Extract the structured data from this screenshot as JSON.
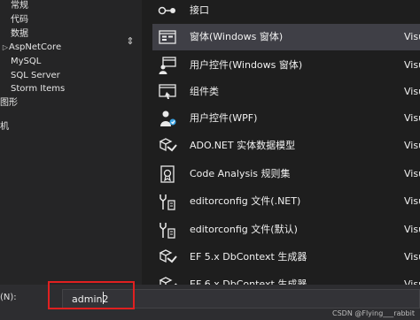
{
  "tree": {
    "items": [
      {
        "label": "常规",
        "twisty": ""
      },
      {
        "label": "代码",
        "twisty": ""
      },
      {
        "label": "数据",
        "twisty": ""
      },
      {
        "label": "AspNetCore",
        "twisty": "▷"
      },
      {
        "label": "MySQL",
        "twisty": ""
      },
      {
        "label": "SQL Server",
        "twisty": ""
      },
      {
        "label": "Storm Items",
        "twisty": ""
      },
      {
        "label": "图形",
        "twisty": ""
      },
      {
        "label": "机",
        "twisty": ""
      }
    ],
    "resize_glyph": "⇕"
  },
  "templates": [
    {
      "name": "接口",
      "lang": "",
      "icon": "interface-icon",
      "selected": false
    },
    {
      "name": "窗体(Windows 窗体)",
      "lang": "Visu",
      "icon": "form-icon",
      "selected": true
    },
    {
      "name": "用户控件(Windows 窗体)",
      "lang": "Visu",
      "icon": "user-control-icon",
      "selected": false
    },
    {
      "name": "组件类",
      "lang": "Visu",
      "icon": "component-icon",
      "selected": false
    },
    {
      "name": "用户控件(WPF)",
      "lang": "Visu",
      "icon": "wpf-user-control-icon",
      "selected": false
    },
    {
      "name": "ADO.NET 实体数据模型",
      "lang": "Visu",
      "icon": "entity-model-icon",
      "selected": false
    },
    {
      "name": "Code Analysis 规则集",
      "lang": "Visu",
      "icon": "ruleset-icon",
      "selected": false
    },
    {
      "name": "editorconfig 文件(.NET)",
      "lang": "Visu",
      "icon": "editorconfig-icon",
      "selected": false
    },
    {
      "name": "editorconfig 文件(默认)",
      "lang": "Visu",
      "icon": "editorconfig-icon",
      "selected": false
    },
    {
      "name": "EF 5.x DbContext 生成器",
      "lang": "Visu",
      "icon": "dbcontext-icon",
      "selected": false
    },
    {
      "name": "EF 6.x DbContext 生成器",
      "lang": "Visu",
      "icon": "dbcontext-icon",
      "selected": false
    }
  ],
  "name_field": {
    "label": "(N):",
    "value": "admin2"
  },
  "watermark": "CSDN @Flying___rabbit",
  "colors": {
    "background": "#1e1e1e",
    "selected_row": "#3f3f46",
    "highlight_box": "#e02020"
  }
}
